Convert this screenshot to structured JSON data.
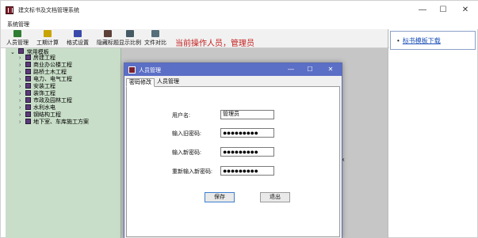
{
  "app": {
    "title": "建文标书及文档管理系统",
    "menu": [
      "系统管理"
    ]
  },
  "toolbar": {
    "items": [
      {
        "label": "人员管理",
        "icon": "users-icon",
        "color": "#2e7d32"
      },
      {
        "label": "工期计算",
        "icon": "calculator-icon",
        "color": "#c8a400"
      },
      {
        "label": "格式设置",
        "icon": "format-icon",
        "color": "#3949ab"
      },
      {
        "label": "隐藏标题",
        "icon": "hide-icon",
        "color": "#5d4037"
      },
      {
        "label": "显示比例",
        "icon": "zoom-icon",
        "color": "#455a64"
      },
      {
        "label": "文件对比",
        "icon": "compare-icon",
        "color": "#546e7a"
      }
    ],
    "current_operator": "当前操作人员，管理员"
  },
  "tree": {
    "root": "常用模板",
    "items": [
      "房建工程",
      "商业办公楼工程",
      "路桥土木工程",
      "电力、电气工程",
      "安装工程",
      "装饰工程",
      "市政及园林工程",
      "水利水电",
      "钢结构工程",
      "地下室、车库施工方案"
    ]
  },
  "right_panel": {
    "link": "标书模板下载"
  },
  "dialog": {
    "title": "人员管理",
    "tabs": [
      "密码修改",
      "人员管理"
    ],
    "fields": {
      "username_label": "用户名:",
      "username_value": "管理员",
      "old_pw_label": "输入旧密码:",
      "old_pw_value": "●●●●●●●●●",
      "new_pw_label": "输入新密码:",
      "new_pw_value": "●●●●●●●●●",
      "confirm_pw_label": "重新输入新密码:",
      "confirm_pw_value": "●●●●●●●●●"
    },
    "save_label": "保存",
    "exit_label": "退出"
  },
  "misc": {
    "stray_mark": "x"
  }
}
